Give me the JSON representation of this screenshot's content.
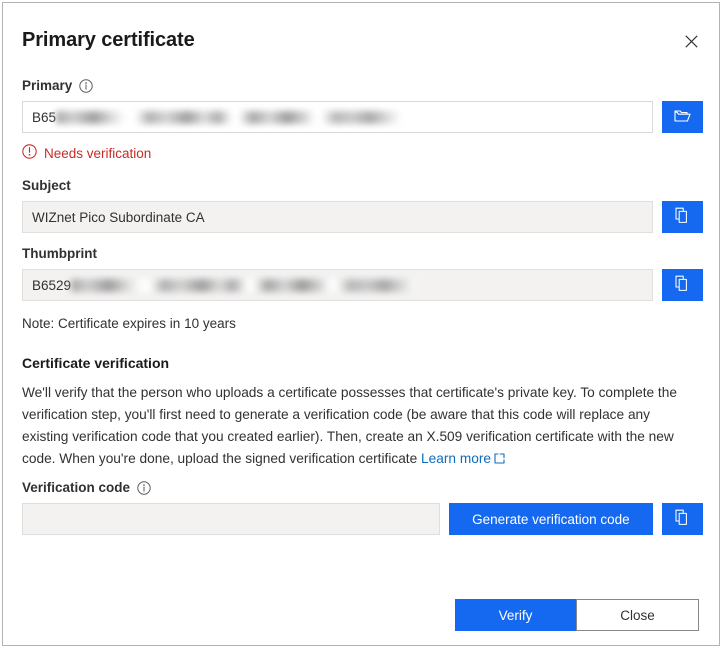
{
  "dialog": {
    "title": "Primary certificate",
    "close_icon": "close-icon"
  },
  "primary_field": {
    "label": "Primary",
    "info_icon": "info-icon",
    "value_prefix": "B65",
    "value_redacted": true,
    "browse_icon": "folder-open-icon",
    "error": {
      "icon": "error-circle-icon",
      "text": "Needs verification"
    }
  },
  "subject_field": {
    "label": "Subject",
    "value": "WIZnet Pico Subordinate CA",
    "copy_icon": "copy-icon"
  },
  "thumbprint_field": {
    "label": "Thumbprint",
    "value_prefix": "B6529",
    "value_redacted": true,
    "copy_icon": "copy-icon"
  },
  "note": "Note: Certificate expires in 10 years",
  "verification_section": {
    "heading": "Certificate verification",
    "paragraph": "We'll verify that the person who uploads a certificate possesses that certificate's private key. To complete the verification step, you'll first need to generate a verification code (be aware that this code will replace any existing verification code that you created earlier). Then, create an X.509 verification certificate with the new code. When you're done, upload the signed verification certificate ",
    "link_text": "Learn more",
    "link_icon": "external-link-icon"
  },
  "verification_code_field": {
    "label": "Verification code",
    "info_icon": "info-icon",
    "value": "",
    "placeholder": "",
    "generate_button_label": "Generate verification code",
    "copy_icon": "copy-icon"
  },
  "footer": {
    "verify_label": "Verify",
    "close_label": "Close"
  },
  "colors": {
    "accent": "#1569f0",
    "link": "#0f6cbd",
    "error": "#c72b25",
    "text": "#323130",
    "readonly_bg": "#f3f2f1",
    "border": "#b3b3b3"
  }
}
